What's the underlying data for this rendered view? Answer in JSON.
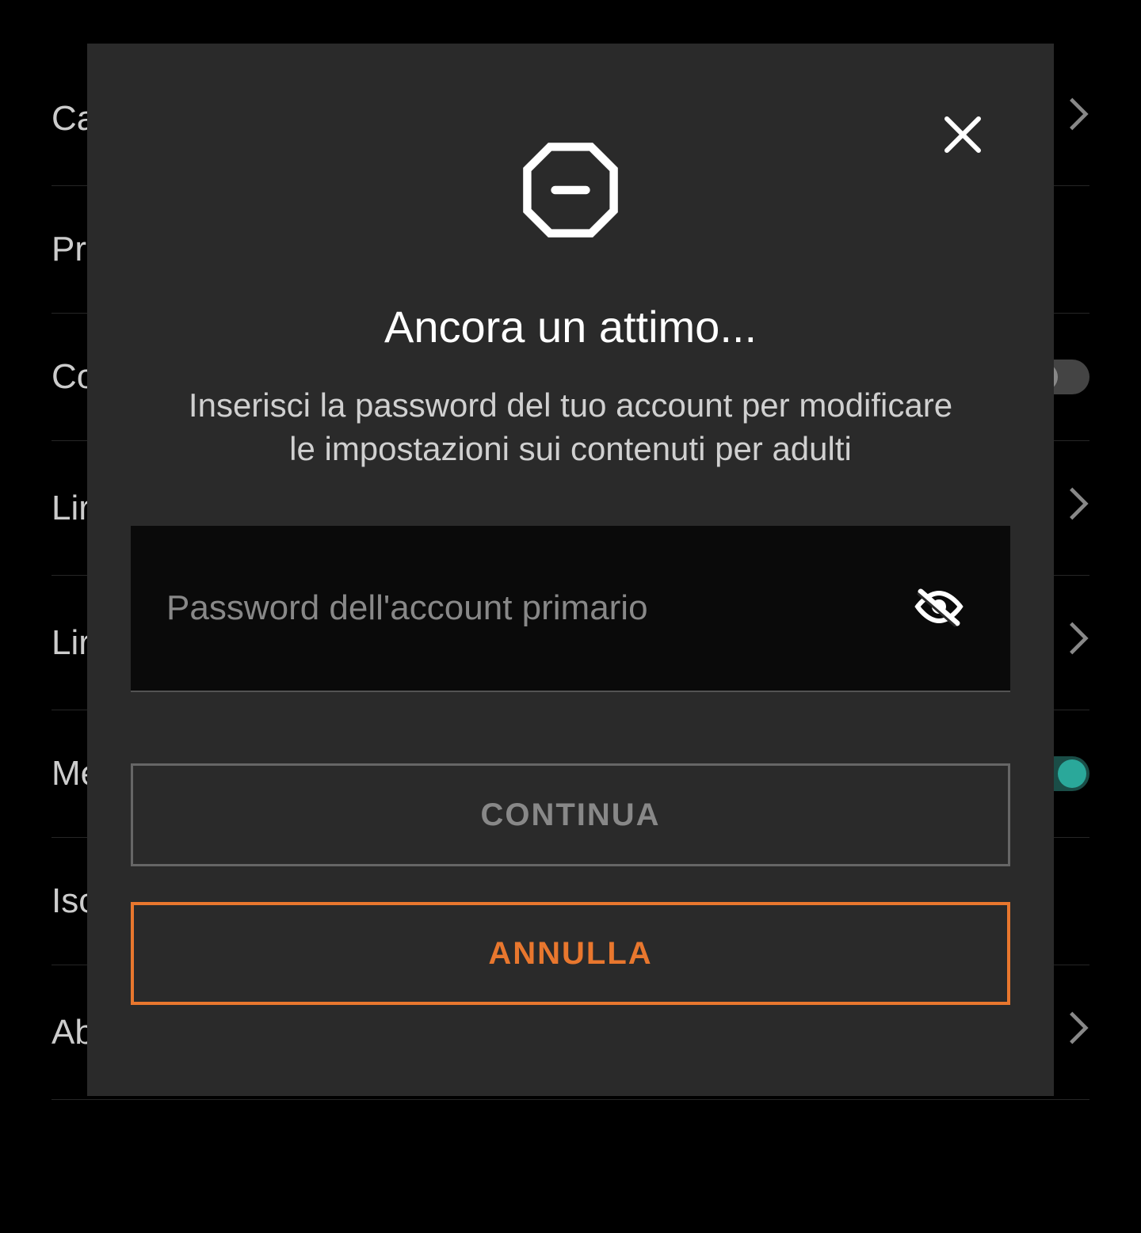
{
  "background": {
    "items": [
      {
        "label": "Ca",
        "action": "chevron"
      },
      {
        "label": "Pr",
        "action": "none"
      },
      {
        "label": "Co",
        "action": "toggle-off"
      },
      {
        "label": "Lir",
        "action": "chevron"
      },
      {
        "label": "Lir",
        "action": "chevron"
      },
      {
        "label": "Me",
        "action": "toggle-on"
      },
      {
        "label": "Isc",
        "action": "none"
      },
      {
        "label": "Ab",
        "action": "chevron"
      }
    ]
  },
  "modal": {
    "title": "Ancora un attimo...",
    "description": "Inserisci la password del tuo account per modificare le impostazioni sui contenuti per adulti",
    "password_placeholder": "Password dell'account primario",
    "continue_label": "CONTINUA",
    "cancel_label": "ANNULLA"
  }
}
